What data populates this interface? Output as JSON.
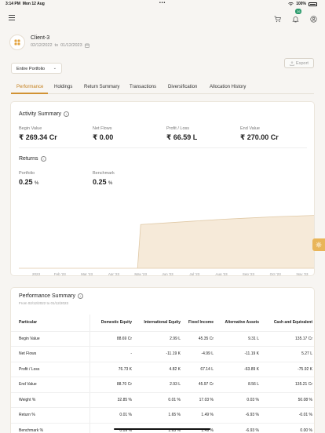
{
  "status_bar": {
    "time": "3:14 PM",
    "date": "Mon 12 Aug",
    "battery": "100%"
  },
  "header": {
    "notification_count": "26"
  },
  "client": {
    "name": "Client-3",
    "date_from": "02/12/2022",
    "date_to": "01/12/2023",
    "date_separator": "to"
  },
  "portfolio_select": {
    "value": "Entire Portfolio"
  },
  "export_label": "Export",
  "tabs": [
    {
      "label": "Performance"
    },
    {
      "label": "Holdings"
    },
    {
      "label": "Return Summary"
    },
    {
      "label": "Transactions"
    },
    {
      "label": "Diversification"
    },
    {
      "label": "Allocation History"
    }
  ],
  "activity_summary": {
    "title": "Activity Summary",
    "metrics": [
      {
        "label": "Begin Value",
        "value": "₹ 269.34 Cr"
      },
      {
        "label": "Net Flows",
        "value": "₹ 0.00"
      },
      {
        "label": "Profit / Loss",
        "value": "₹ 66.59 L"
      },
      {
        "label": "End Value",
        "value": "₹ 270.00 Cr"
      }
    ]
  },
  "returns": {
    "title": "Returns",
    "metrics": [
      {
        "label": "Portfolio",
        "value": "0.25",
        "unit": "%"
      },
      {
        "label": "Benchmark",
        "value": "0.25",
        "unit": "%"
      }
    ]
  },
  "chart_data": {
    "type": "area",
    "title": "",
    "xlabel": "",
    "ylabel": "",
    "x": [
      "2023",
      "Feb '23",
      "Mar '23",
      "Apr '23",
      "May '23",
      "Jun '23",
      "Jul '23",
      "Aug '23",
      "Sep '23",
      "Oct '23",
      "Nov '23"
    ],
    "series": [
      {
        "values": [
          0,
          0,
          0,
          0,
          1.0,
          1.04,
          1.08,
          1.12,
          1.15,
          1.18,
          1.2
        ]
      }
    ],
    "grid": false,
    "fill_color": "#f6ead9",
    "line_color": "#e0c9a6"
  },
  "performance_summary": {
    "title": "Performance Summary",
    "subtitle": "From 02/12/2022 to 01/12/2023",
    "columns": [
      "Particular",
      "Domestic Equity",
      "International Equity",
      "Fixed Income",
      "Alternative Assets",
      "Cash and Equivalent"
    ],
    "rows": [
      [
        "Begin Value",
        "88.69 Cr",
        "2.99 L",
        "45.35 Cr",
        "9.31 L",
        "135.17 Cr"
      ],
      [
        "Net Flows",
        "-",
        "-11.19 K",
        "-4.99 L",
        "-11.19 K",
        "5.27 L"
      ],
      [
        "Profit / Loss",
        "76.73 K",
        "4.82 K",
        "67.14 L",
        "-63.89 K",
        "-75.92 K"
      ],
      [
        "End Value",
        "88.70 Cr",
        "2.93 L",
        "45.97 Cr",
        "8.56 L",
        "135.21 Cr"
      ],
      [
        "Weight %",
        "32.85 %",
        "0.01 %",
        "17.03 %",
        "0.03 %",
        "50.08 %"
      ],
      [
        "Return %",
        "0.01 %",
        "1.65 %",
        "1.49 %",
        "-6.93 %",
        "-0.01 %"
      ],
      [
        "Benchmark %",
        "0.09 %",
        "1.65 %",
        "1.49 %",
        "-6.93 %",
        "0.00 %"
      ]
    ]
  },
  "colors": {
    "accent": "#c47f1c",
    "tab_underline": "#d19233",
    "badge": "#2a9a6b",
    "float_button": "#e9b559"
  },
  "icons": [
    "menu-icon",
    "cart-icon",
    "bell-icon",
    "user-icon",
    "portfolio-icon",
    "calendar-icon",
    "chevron-down-icon",
    "export-icon",
    "info-icon",
    "gear-icon"
  ]
}
